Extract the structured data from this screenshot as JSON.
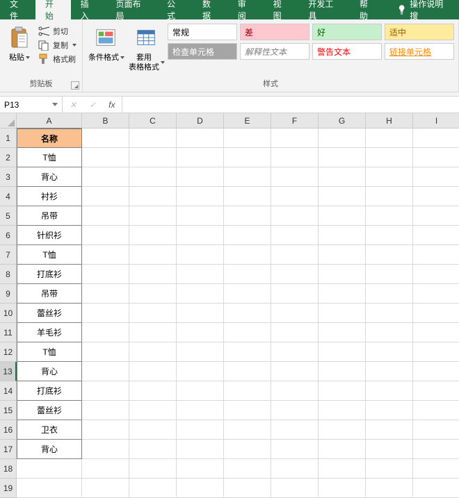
{
  "menu": {
    "file": "文件",
    "home": "开始",
    "insert": "插入",
    "layout": "页面布局",
    "formula": "公式",
    "data": "数据",
    "review": "审阅",
    "view": "视图",
    "dev": "开发工具",
    "help": "帮助",
    "tellme": "操作说明搜"
  },
  "ribbon": {
    "clipboard": {
      "paste": "粘贴",
      "cut": "剪切",
      "copy": "复制",
      "format_painter": "格式刷",
      "label": "剪贴板"
    },
    "styles": {
      "cond_format": "条件格式",
      "table_format": "套用\n表格格式",
      "normal": "常规",
      "bad": "差",
      "good": "好",
      "neutral": "适中",
      "check_cell": "检查单元格",
      "explain": "解释性文本",
      "warn": "警告文本",
      "link": "链接单元格",
      "label": "样式"
    }
  },
  "namebox": "P13",
  "fx_label": "fx",
  "columns": [
    "A",
    "B",
    "C",
    "D",
    "E",
    "F",
    "G",
    "H",
    "I"
  ],
  "headerRow": "名称",
  "rows": [
    "T恤",
    "背心",
    "衬衫",
    "吊带",
    "针织衫",
    "T恤",
    "打底衫",
    "吊带",
    "蕾丝衫",
    "羊毛衫",
    "T恤",
    "背心",
    "打底衫",
    "蕾丝衫",
    "卫衣",
    "背心"
  ],
  "selectedRow": 13,
  "blankRowCount": 2
}
